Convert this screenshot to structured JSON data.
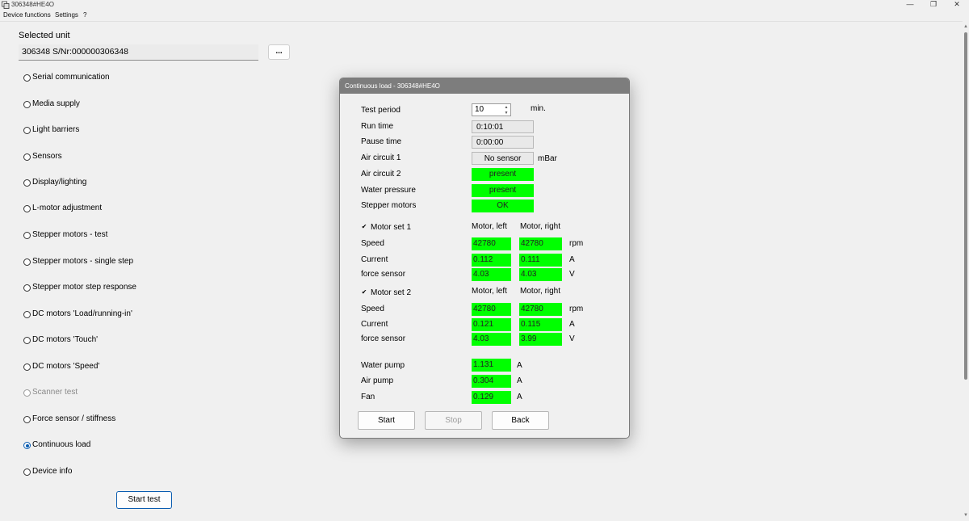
{
  "app": {
    "title": "306348#HE4O",
    "menu": [
      "Device functions",
      "Settings",
      "?"
    ],
    "window_buttons": {
      "minimize": "—",
      "maximize": "❐",
      "close": "✕"
    }
  },
  "main": {
    "selected_unit_label": "Selected unit",
    "selected_unit_value": "306348 S/Nr:000000306348",
    "browse_label": "...",
    "start_test_label": "Start test",
    "functions": [
      {
        "label": "Serial communication",
        "checked": false,
        "disabled": false
      },
      {
        "label": "Media supply",
        "checked": false,
        "disabled": false
      },
      {
        "label": "Light barriers",
        "checked": false,
        "disabled": false
      },
      {
        "label": "Sensors",
        "checked": false,
        "disabled": false
      },
      {
        "label": "Display/lighting",
        "checked": false,
        "disabled": false
      },
      {
        "label": "L-motor adjustment",
        "checked": false,
        "disabled": false
      },
      {
        "label": "Stepper motors - test",
        "checked": false,
        "disabled": false
      },
      {
        "label": "Stepper motors - single step",
        "checked": false,
        "disabled": false
      },
      {
        "label": "Stepper motor step response",
        "checked": false,
        "disabled": false
      },
      {
        "label": "DC motors 'Load/running-in'",
        "checked": false,
        "disabled": false
      },
      {
        "label": "DC motors 'Touch'",
        "checked": false,
        "disabled": false
      },
      {
        "label": "DC motors 'Speed'",
        "checked": false,
        "disabled": false
      },
      {
        "label": "Scanner test",
        "checked": false,
        "disabled": true
      },
      {
        "label": "Force sensor / stiffness",
        "checked": false,
        "disabled": false
      },
      {
        "label": "Continuous load",
        "checked": true,
        "disabled": false
      },
      {
        "label": "Device info",
        "checked": false,
        "disabled": false
      }
    ]
  },
  "dialog": {
    "title": "Continuous load - 306348#HE4O",
    "test_period": {
      "label": "Test period",
      "value": "10",
      "unit": "min."
    },
    "run_time": {
      "label": "Run time",
      "value": "0:10:01"
    },
    "pause_time": {
      "label": "Pause time",
      "value": "0:00:00"
    },
    "air_circuit_1": {
      "label": "Air circuit 1",
      "value": "No sensor",
      "unit": "mBar"
    },
    "air_circuit_2": {
      "label": "Air circuit 2",
      "value": "present"
    },
    "water_pressure": {
      "label": "Water pressure",
      "value": "present"
    },
    "stepper_motors": {
      "label": "Stepper motors",
      "value": "OK"
    },
    "motor_set_1": {
      "label": "Motor set 1",
      "checked": true,
      "col_left": "Motor, left",
      "col_right": "Motor, right",
      "speed": {
        "label": "Speed",
        "left": "42780",
        "right": "42780",
        "unit": "rpm"
      },
      "current": {
        "label": "Current",
        "left": "0.112",
        "right": "0.111",
        "unit": "A"
      },
      "force": {
        "label": "force sensor",
        "left": "4.03",
        "right": "4.03",
        "unit": "V"
      }
    },
    "motor_set_2": {
      "label": "Motor set 2",
      "checked": true,
      "col_left": "Motor, left",
      "col_right": "Motor, right",
      "speed": {
        "label": "Speed",
        "left": "42780",
        "right": "42780",
        "unit": "rpm"
      },
      "current": {
        "label": "Current",
        "left": "0.121",
        "right": "0.115",
        "unit": "A"
      },
      "force": {
        "label": "force sensor",
        "left": "4.03",
        "right": "3.99",
        "unit": "V"
      }
    },
    "water_pump": {
      "label": "Water pump",
      "value": "1.131",
      "unit": "A"
    },
    "air_pump": {
      "label": "Air pump",
      "value": "0.304",
      "unit": "A"
    },
    "fan": {
      "label": "Fan",
      "value": "0.129",
      "unit": "A"
    },
    "buttons": {
      "start": "Start",
      "stop": "Stop",
      "back": "Back"
    },
    "status_color": "#00ff00"
  }
}
